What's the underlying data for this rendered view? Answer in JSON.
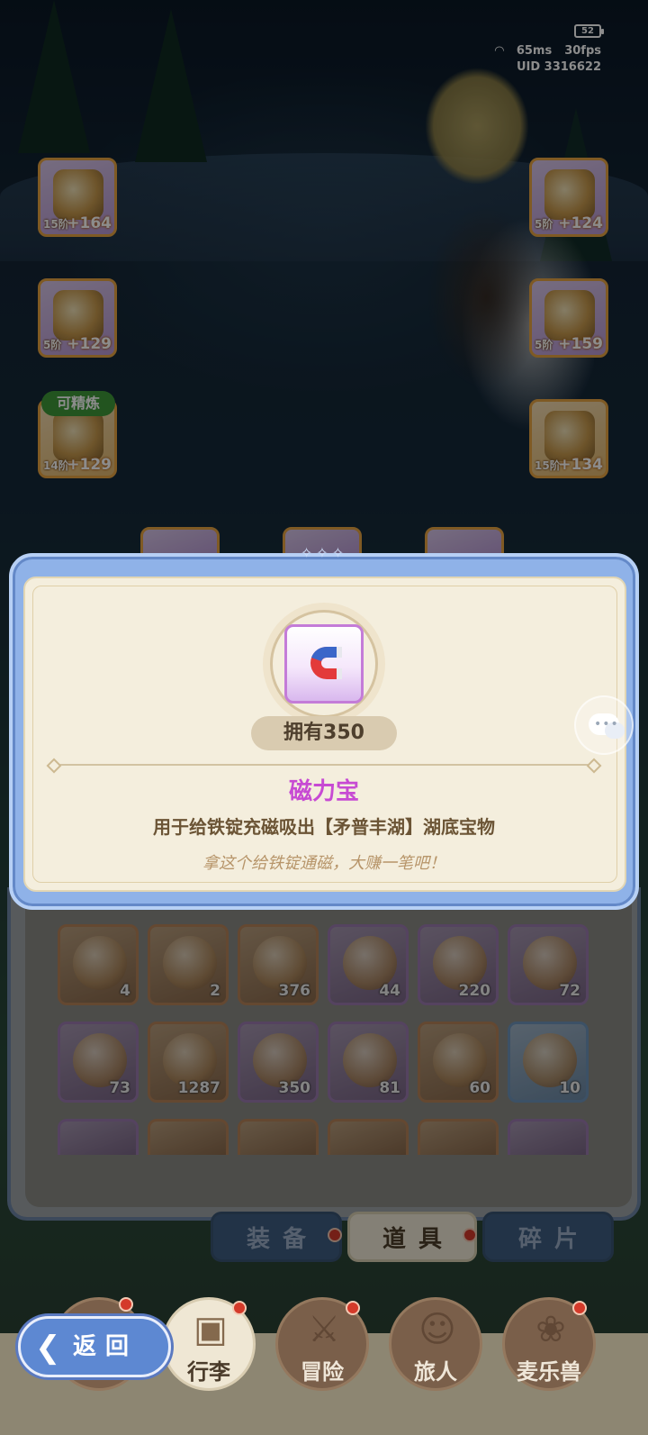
{
  "hud": {
    "battery": "52",
    "ping": "65ms",
    "fps": "30fps",
    "uid_label": "UID",
    "uid": "3316622"
  },
  "equipment": {
    "left": [
      {
        "level": "15阶",
        "bonus": "+164"
      },
      {
        "level": "5阶",
        "bonus": "+129"
      },
      {
        "level": "14阶",
        "bonus": "+129",
        "tag": "可精炼"
      }
    ],
    "right": [
      {
        "level": "5阶",
        "bonus": "+124"
      },
      {
        "level": "5阶",
        "bonus": "+159"
      },
      {
        "level": "15阶",
        "bonus": "+134"
      }
    ]
  },
  "modal": {
    "owned_label": "拥有350",
    "item_name": "磁力宝",
    "description": "用于给铁锭充磁吸出【矛普丰湖】湖底宝物",
    "flavor": "拿这个给铁锭通磁，大赚一笔吧！",
    "name_color": "#c74ad3"
  },
  "inventory": {
    "row1": [
      {
        "count": "4",
        "icon": "bottle-icon"
      },
      {
        "count": "2",
        "icon": "card-icon"
      },
      {
        "count": "376",
        "icon": "bell-icon"
      },
      {
        "count": "44",
        "icon": "horseshoe-icon"
      },
      {
        "count": "220",
        "icon": "drink-icon"
      },
      {
        "count": "72",
        "icon": "gold-seal-icon"
      }
    ],
    "row2": [
      {
        "count": "73",
        "icon": "paw-bag-icon"
      },
      {
        "count": "1287",
        "icon": "star-crystal-icon"
      },
      {
        "count": "350",
        "icon": "magnet-icon"
      },
      {
        "count": "81",
        "icon": "purple-gem-icon"
      },
      {
        "count": "60",
        "icon": "golden-helmet-icon"
      },
      {
        "count": "10",
        "icon": "red-glove-icon"
      }
    ]
  },
  "tabs": [
    {
      "label": "装备",
      "active": false
    },
    {
      "label": "道具",
      "active": true
    },
    {
      "label": "碎片",
      "active": false
    }
  ],
  "nav": [
    {
      "label": "行李",
      "icon": "luggage-icon",
      "active": true
    },
    {
      "label": "冒险",
      "icon": "swords-icon",
      "active": false
    },
    {
      "label": "旅人",
      "icon": "traveler-icon",
      "active": false
    },
    {
      "label": "麦乐兽",
      "icon": "pet-icon",
      "active": false
    }
  ],
  "back_label": "返回"
}
